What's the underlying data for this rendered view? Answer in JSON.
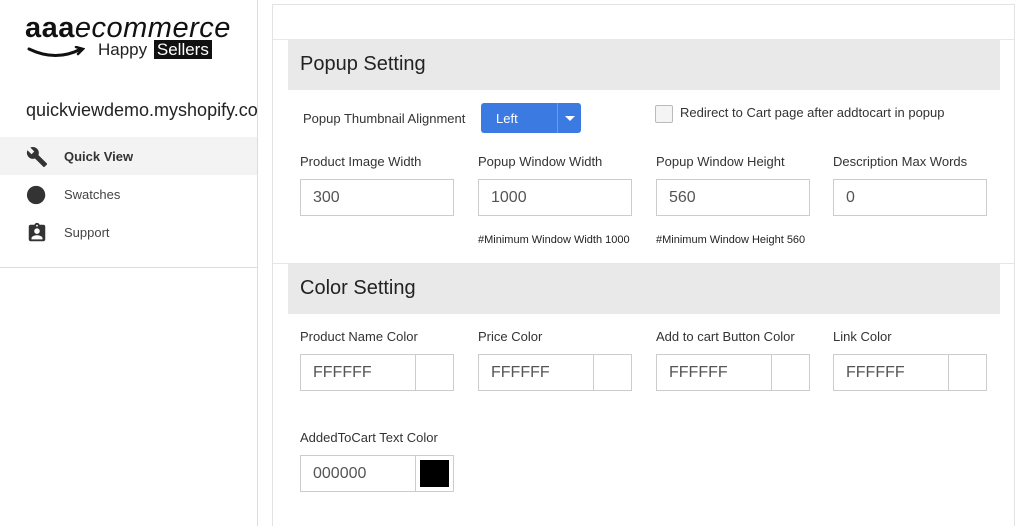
{
  "logo": {
    "brand_bold": "aaa",
    "brand_italic": "ecommerce",
    "tagline": "Happy",
    "tagline_highlight": "Sellers"
  },
  "shop": {
    "domain": "quickviewdemo.myshopify.com"
  },
  "nav": {
    "items": [
      {
        "label": "Quick View",
        "icon": "wrench-icon",
        "active": true
      },
      {
        "label": "Swatches",
        "icon": "circle-icon",
        "active": false
      },
      {
        "label": "Support",
        "icon": "contact-badge-icon",
        "active": false
      }
    ]
  },
  "popup": {
    "title": "Popup Setting",
    "thumbnail_alignment_label": "Popup Thumbnail Alignment",
    "thumbnail_alignment_value": "Left",
    "redirect_label": "Redirect to Cart page after addtocart in popup",
    "redirect_checked": false,
    "fields": [
      {
        "label": "Product Image Width",
        "value": "300",
        "hint": ""
      },
      {
        "label": "Popup Window Width",
        "value": "1000",
        "hint": "#Minimum Window Width 1000"
      },
      {
        "label": "Popup Window Height",
        "value": "560",
        "hint": "#Minimum Window Height 560"
      },
      {
        "label": "Description Max Words",
        "value": "0",
        "hint": ""
      }
    ]
  },
  "color": {
    "title": "Color Setting",
    "fields": [
      {
        "label": "Product Name Color",
        "value": "FFFFFF",
        "swatch": "#FFFFFF"
      },
      {
        "label": "Price Color",
        "value": "FFFFFF",
        "swatch": "#FFFFFF"
      },
      {
        "label": "Add to cart Button Color",
        "value": "FFFFFF",
        "swatch": "#FFFFFF"
      },
      {
        "label": "Link Color",
        "value": "FFFFFF",
        "swatch": "#FFFFFF"
      },
      {
        "label": "AddedToCart Text Color",
        "value": "000000",
        "swatch": "#000000"
      }
    ]
  },
  "colors": {
    "accent": "#3b7ae0",
    "section_bg": "#e9e9e9",
    "active_nav_bg": "#f3f3f3"
  }
}
